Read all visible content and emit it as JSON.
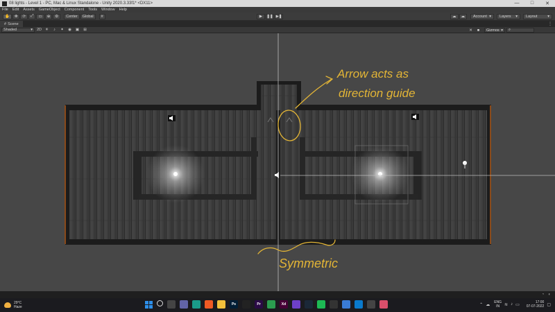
{
  "window": {
    "title": "08 lights - Level 1 - PC, Mac & Linux Standalone - Unity 2020.3.33f1* <DX11>",
    "controls": [
      "—",
      "□",
      "✕"
    ]
  },
  "menu": [
    "File",
    "Edit",
    "Assets",
    "GameObject",
    "Component",
    "Tools",
    "Window",
    "Help"
  ],
  "toolbar": {
    "tools": [
      "hand-tool",
      "move-tool",
      "rotate-tool",
      "scale-tool",
      "rect-tool",
      "transform-tool",
      "custom-tool"
    ],
    "pivot_label": "Center",
    "space_label": "Global",
    "play_controls": [
      "▶",
      "❚❚",
      "▶❚"
    ],
    "account_label": "Account",
    "layers_label": "Layers",
    "layout_label": "Layout"
  },
  "scene": {
    "tab_label": "Scene",
    "shading_mode": "Shaded",
    "mode_2d_label": "2D",
    "gizmos_label": "Gizmos",
    "search_placeholder": "All"
  },
  "annotations": {
    "arrow_note_line1": "Arrow acts as",
    "arrow_note_line2": "direction guide",
    "symmetric_note": "Symmetric",
    "annotation_color": "#e3b536"
  },
  "taskbar": {
    "weather_temp": "29°C",
    "weather_desc": "Haze",
    "apps": [
      {
        "name": "windows-start",
        "label": "",
        "color": "#2d8ee8"
      },
      {
        "name": "search",
        "label": "",
        "color": "#1b1b1f"
      },
      {
        "name": "task-view",
        "label": "",
        "color": "#444"
      },
      {
        "name": "teams",
        "label": "",
        "color": "#6264a7"
      },
      {
        "name": "edge",
        "label": "",
        "color": "#1a9b8a"
      },
      {
        "name": "brave",
        "label": "",
        "color": "#f05a24"
      },
      {
        "name": "file-explorer",
        "label": "",
        "color": "#f3c03b"
      },
      {
        "name": "photoshop",
        "label": "Ps",
        "color": "#001e36"
      },
      {
        "name": "unity",
        "label": "",
        "color": "#222"
      },
      {
        "name": "premiere",
        "label": "Pr",
        "color": "#2a0a46"
      },
      {
        "name": "chrome",
        "label": "",
        "color": "#2b9d4f"
      },
      {
        "name": "xd",
        "label": "Xd",
        "color": "#470137"
      },
      {
        "name": "github",
        "label": "",
        "color": "#6e40c9"
      },
      {
        "name": "steam",
        "label": "",
        "color": "#1b2838"
      },
      {
        "name": "spotify",
        "label": "",
        "color": "#1db954"
      },
      {
        "name": "epic-games",
        "label": "",
        "color": "#333"
      },
      {
        "name": "app-blue",
        "label": "",
        "color": "#3a7bd5"
      },
      {
        "name": "visual-studio-code",
        "label": "",
        "color": "#0a7acc"
      },
      {
        "name": "unity-hub",
        "label": "",
        "color": "#444"
      },
      {
        "name": "snipping-tool",
        "label": "",
        "color": "#d94f6b"
      }
    ],
    "language": "ENG",
    "region": "IN",
    "time": "17:00",
    "date": "07-07-2022"
  },
  "colors": {
    "viewport_bg": "#474747",
    "wall": "#1c1c1c",
    "floor": "#3b3b3b",
    "light_glow": "#ffffff",
    "annotation": "#e3b536"
  }
}
